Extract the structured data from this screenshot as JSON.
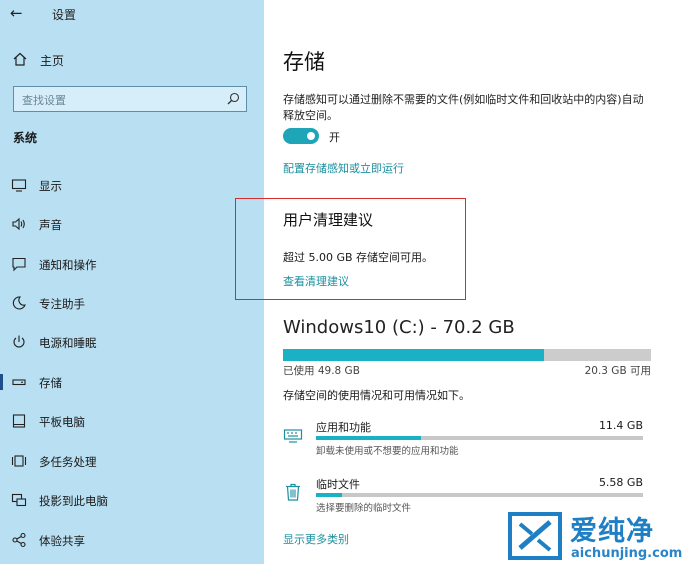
{
  "app": {
    "title": "设置",
    "back_icon": "back-arrow-icon"
  },
  "sidebar": {
    "home_label": "主页",
    "search_placeholder": "查找设置",
    "section_label": "系统",
    "items": [
      {
        "label": "显示",
        "icon": "display-icon"
      },
      {
        "label": "声音",
        "icon": "sound-icon"
      },
      {
        "label": "通知和操作",
        "icon": "notification-icon"
      },
      {
        "label": "专注助手",
        "icon": "focus-assist-icon"
      },
      {
        "label": "电源和睡眠",
        "icon": "power-icon"
      },
      {
        "label": "存储",
        "icon": "storage-icon",
        "active": true
      },
      {
        "label": "平板电脑",
        "icon": "tablet-icon"
      },
      {
        "label": "多任务处理",
        "icon": "multitasking-icon"
      },
      {
        "label": "投影到此电脑",
        "icon": "project-icon"
      },
      {
        "label": "体验共享",
        "icon": "shared-experience-icon"
      }
    ]
  },
  "main": {
    "title": "存储",
    "description": "存储感知可以通过删除不需要的文件(例如临时文件和回收站中的内容)自动释放空间。",
    "toggle_label": "开",
    "toggle_on": true,
    "configure_link": "配置存储感知或立即运行",
    "recommendations": {
      "title": "用户清理建议",
      "text": "超过 5.00 GB 存储空间可用。",
      "link": "查看清理建议"
    },
    "drive": {
      "title": "Windows10 (C:) - 70.2 GB",
      "used_label": "已使用 49.8 GB",
      "free_label": "20.3 GB 可用",
      "used_fraction": 0.71
    },
    "usage_description": "存储空间的使用情况和可用情况如下。",
    "categories": [
      {
        "name": "应用和功能",
        "size": "11.4 GB",
        "sub": "卸载未使用或不想要的应用和功能",
        "fraction": 0.32,
        "icon": "apps-keyboard-icon"
      },
      {
        "name": "临时文件",
        "size": "5.58 GB",
        "sub": "选择要删除的临时文件",
        "fraction": 0.08,
        "icon": "trash-icon"
      }
    ],
    "more_link": "显示更多类别"
  },
  "watermark": {
    "brand": "爱纯净",
    "url": "aichunjing.com"
  },
  "colors": {
    "sidebar_bg": "#b9dff2",
    "accent": "#1ab1c4",
    "link": "#1a8fa0",
    "highlight_border": "#d52b2b"
  }
}
